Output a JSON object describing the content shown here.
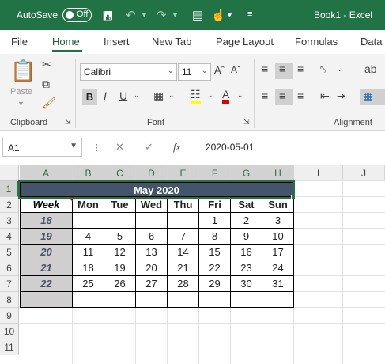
{
  "titlebar": {
    "autosave": "AutoSave",
    "toggle": "Off",
    "document": "Book1  -  Excel"
  },
  "tabs": [
    "File",
    "Home",
    "Insert",
    "New Tab",
    "Page Layout",
    "Formulas",
    "Data"
  ],
  "ribbon": {
    "font_name": "Calibri",
    "font_size": "11",
    "paste_label": "Paste",
    "groups": {
      "clipboard": "Clipboard",
      "font": "Font",
      "alignment": "Alignment"
    }
  },
  "formula_bar": {
    "name_box": "A1",
    "formula": "2020-05-01"
  },
  "columns": [
    "A",
    "B",
    "C",
    "D",
    "E",
    "F",
    "G",
    "H",
    "I",
    "J"
  ],
  "rows": [
    "1",
    "2",
    "3",
    "4",
    "5",
    "6",
    "7",
    "8",
    "9",
    "10",
    "11"
  ],
  "calendar": {
    "title": "May 2020",
    "week_header": "Week",
    "days": [
      "Mon",
      "Tue",
      "Wed",
      "Thu",
      "Fri",
      "Sat",
      "Sun"
    ],
    "weeks": [
      {
        "week": "18",
        "dates": [
          "",
          "",
          "",
          "",
          "1",
          "2",
          "3"
        ]
      },
      {
        "week": "19",
        "dates": [
          "4",
          "5",
          "6",
          "7",
          "8",
          "9",
          "10"
        ]
      },
      {
        "week": "20",
        "dates": [
          "11",
          "12",
          "13",
          "14",
          "15",
          "16",
          "17"
        ]
      },
      {
        "week": "21",
        "dates": [
          "18",
          "19",
          "20",
          "21",
          "22",
          "23",
          "24"
        ]
      },
      {
        "week": "22",
        "dates": [
          "25",
          "26",
          "27",
          "28",
          "29",
          "30",
          "31"
        ]
      },
      {
        "week": "",
        "dates": [
          "",
          "",
          "",
          "",
          "",
          "",
          ""
        ]
      }
    ]
  },
  "colors": {
    "accent": "#217346",
    "title_fill": "#44546a",
    "week_fill": "#d0cece"
  }
}
